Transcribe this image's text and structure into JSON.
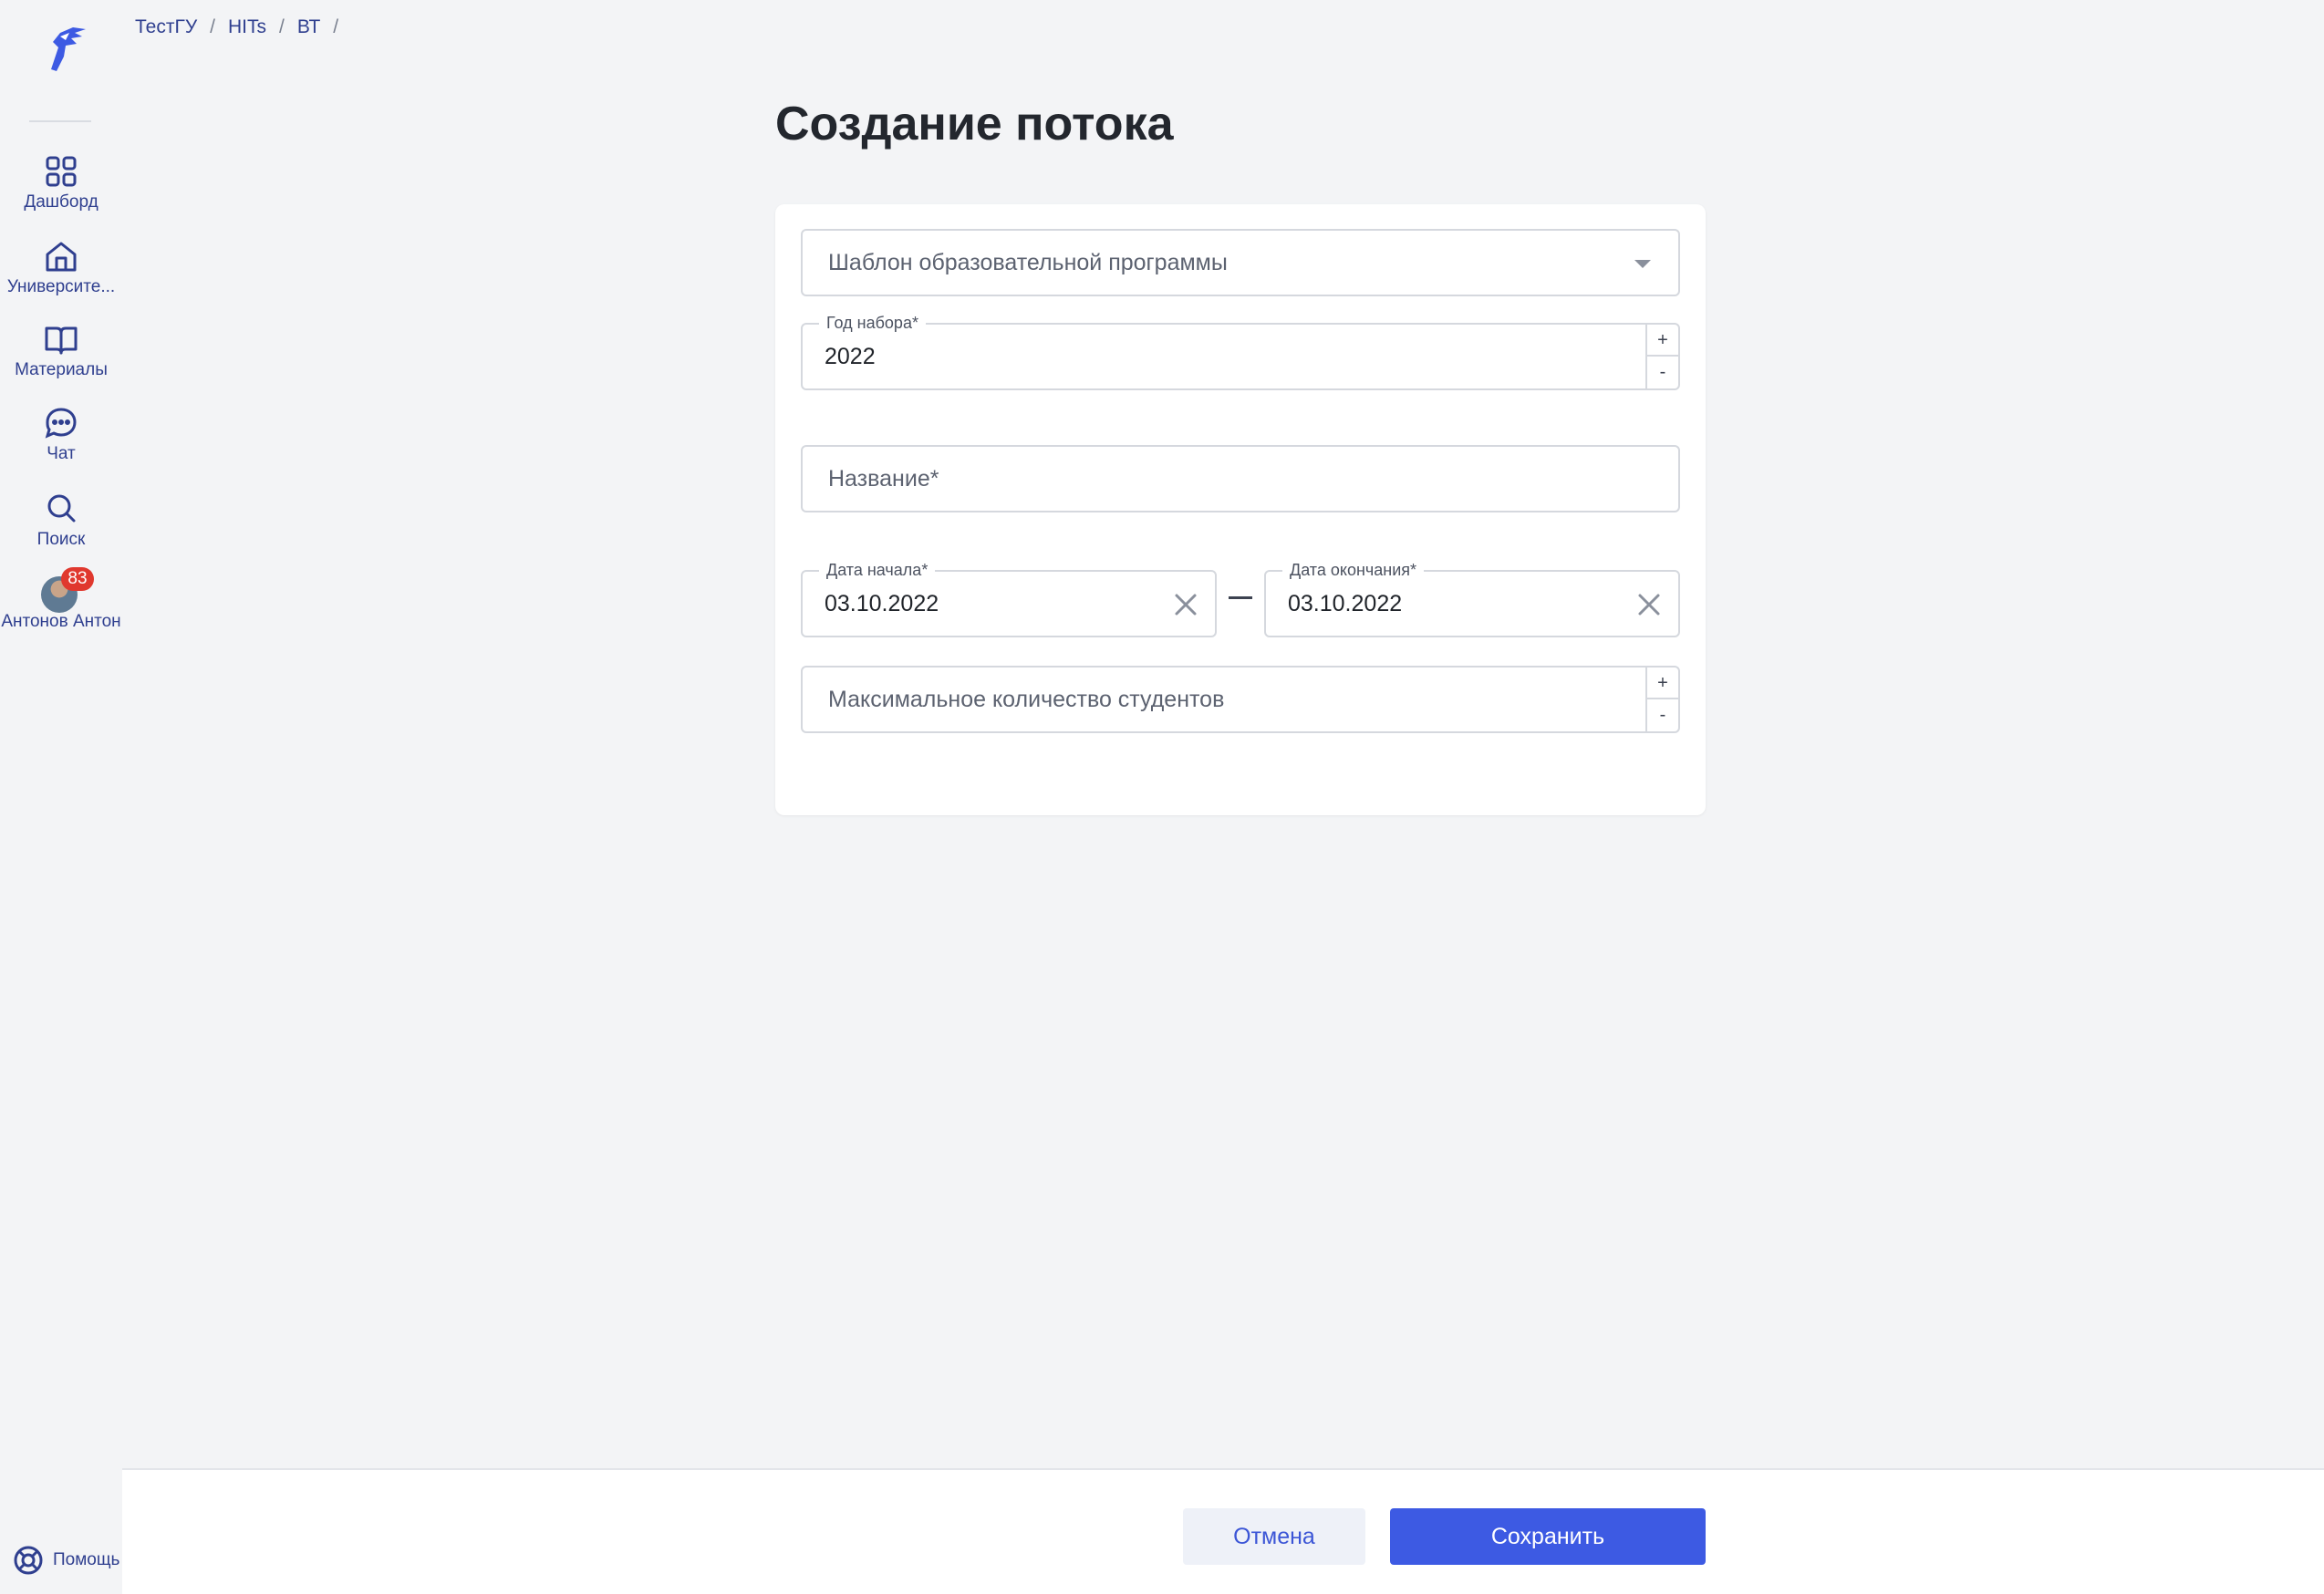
{
  "breadcrumb": [
    "ТестГУ",
    "HITs",
    "ВТ"
  ],
  "breadcrumb_separator": "/",
  "sidebar": {
    "items": [
      {
        "label": "Дашборд",
        "icon": "grid-icon"
      },
      {
        "label": "Университе...",
        "icon": "home-icon"
      },
      {
        "label": "Материалы",
        "icon": "book-icon"
      },
      {
        "label": "Чат",
        "icon": "chat-icon"
      },
      {
        "label": "Поиск",
        "icon": "search-icon"
      }
    ],
    "user": {
      "name": "Антонов Антон",
      "badge": "83"
    },
    "help_label": "Помощь"
  },
  "page": {
    "title": "Создание потока"
  },
  "form": {
    "template_placeholder": "Шаблон образовательной программы",
    "year_label": "Год набора*",
    "year_value": "2022",
    "name_placeholder": "Название*",
    "start_label": "Дата начала*",
    "start_value": "03.10.2022",
    "end_label": "Дата окончания*",
    "end_value": "03.10.2022",
    "max_students_placeholder": "Максимальное количество студентов",
    "stepper_plus": "+",
    "stepper_minus": "-"
  },
  "footer": {
    "cancel_label": "Отмена",
    "save_label": "Сохранить"
  },
  "colors": {
    "accent": "#3d5ae3",
    "nav": "#2f3f8f",
    "badge": "#e0382e",
    "background": "#f3f4f6"
  }
}
